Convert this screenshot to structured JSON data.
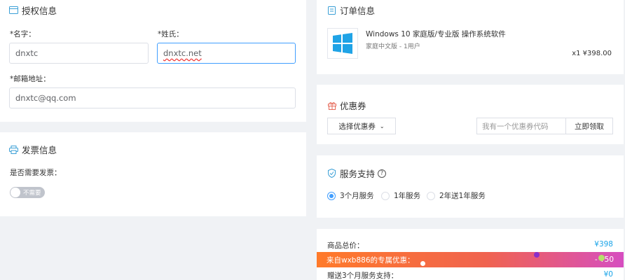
{
  "auth": {
    "title": "授权信息",
    "name_label": "*名字：",
    "name_value": "dnxtc",
    "surname_label": "*姓氏：",
    "surname_value": "dnxtc.net",
    "email_label": "*邮箱地址：",
    "email_value": "dnxtc@qq.com"
  },
  "invoice": {
    "title": "发票信息",
    "need_label": "是否需要发票：",
    "toggle_text": "不需要",
    "toggle_on": false
  },
  "order": {
    "title": "订单信息",
    "product_name": "Windows 10 家庭版/专业版 操作系统软件",
    "product_sub": "家庭中文版 - 1用户",
    "quantity_price": "x1 ¥398.00"
  },
  "coupon": {
    "title": "优惠券",
    "select_label": "选择优惠券",
    "code_placeholder": "我有一个优惠券代码",
    "redeem_label": "立即领取"
  },
  "service": {
    "title": "服务支持",
    "help_icon": "question-icon",
    "options": [
      "3个月服务",
      "1年服务",
      "2年送1年服务"
    ],
    "selected_index": 0
  },
  "summary": {
    "total_label": "商品总价：",
    "total_value": "¥398",
    "promo_label": "来自wxb886的专属优惠：",
    "promo_value": "- ¥50",
    "gift_label": "赠送3个月服务支持：",
    "gift_value": "¥0"
  },
  "colors": {
    "accent": "#409eff",
    "price": "#1aa4e8",
    "icon": "#3a9fd6",
    "coupon_icon": "#e66a5a"
  }
}
